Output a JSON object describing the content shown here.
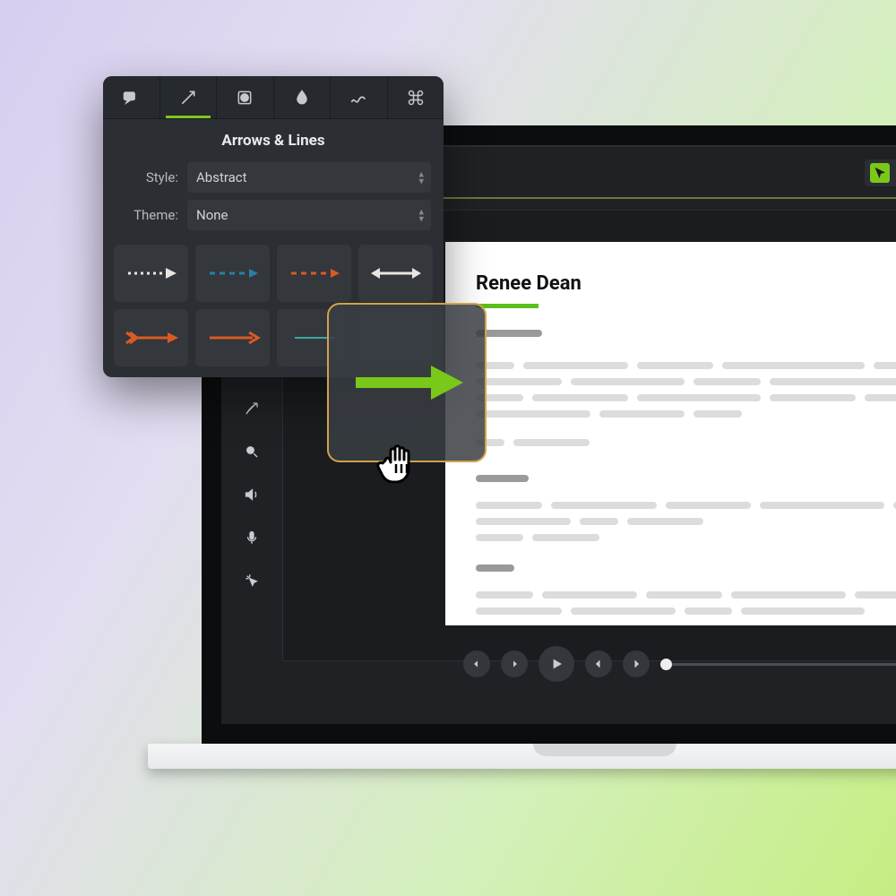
{
  "panel": {
    "title": "Arrows & Lines",
    "style_label": "Style:",
    "theme_label": "Theme:",
    "style_value": "Abstract",
    "theme_value": "None"
  },
  "canvas": {
    "heading": "Renee Dean"
  },
  "colors": {
    "accent_green": "#7ac81a",
    "arrow_orange": "#d95a23",
    "arrow_blue": "#2a7fa8",
    "arrow_teal": "#3aa7a0",
    "arrow_white": "#e8e6df"
  }
}
